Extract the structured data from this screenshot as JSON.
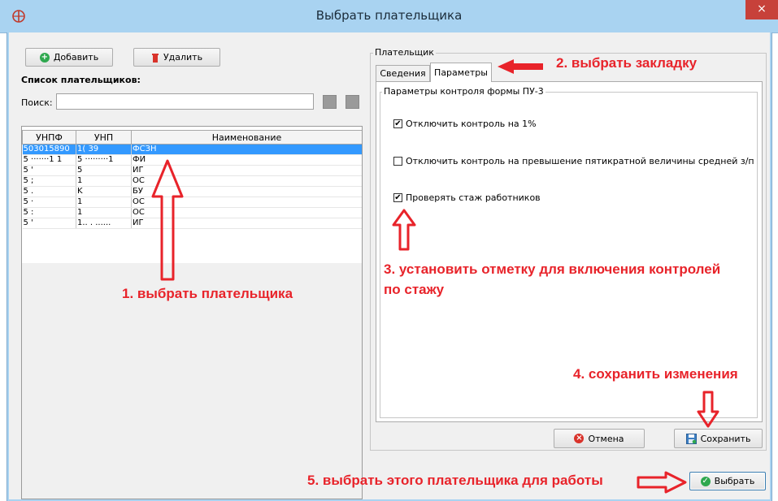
{
  "window": {
    "title": "Выбрать плательщика",
    "close_glyph": "×"
  },
  "toolbar": {
    "add_label": "Добавить",
    "delete_label": "Удалить"
  },
  "payers": {
    "list_title": "Список плательщиков:",
    "search_label": "Поиск:",
    "search_value": "",
    "columns": [
      "УНПФ",
      "УНП",
      "Наименование"
    ],
    "rows": [
      {
        "unpf": "503015890",
        "unp": "1(              39",
        "name": "ФСЗН",
        "selected": true
      },
      {
        "unpf": "5 ·······1 1",
        "unp": "5 ·········1",
        "name": "ФИ",
        "selected": false
      },
      {
        "unpf": "5               '",
        "unp": "5",
        "name": "ИГ",
        "selected": false
      },
      {
        "unpf": "5               ;",
        "unp": "1",
        "name": "ОС",
        "selected": false
      },
      {
        "unpf": "5               .",
        "unp": "K",
        "name": "БУ",
        "selected": false
      },
      {
        "unpf": "5               ·",
        "unp": "1",
        "name": "ОС",
        "selected": false
      },
      {
        "unpf": "5               :",
        "unp": "1",
        "name": "ОС",
        "selected": false
      },
      {
        "unpf": "5               '",
        "unp": "1.. . ......",
        "name": "ИГ",
        "selected": false
      }
    ]
  },
  "payer_panel": {
    "group_title": "Плательщик",
    "tabs": [
      "Сведения",
      "Параметры"
    ],
    "active_tab": "Параметры",
    "section_title": "Параметры контроля формы ПУ-3",
    "checkboxes": [
      {
        "label": "Отключить контроль на 1%",
        "checked": true
      },
      {
        "label": "Отключить контроль на превышение пятикратной величины средней з/п",
        "checked": false
      },
      {
        "label": "Проверять стаж работников",
        "checked": true
      }
    ],
    "cancel_label": "Отмена",
    "save_label": "Сохранить"
  },
  "select_label": "Выбрать",
  "annotations": {
    "step1": "1. выбрать плательщика",
    "step2": "2. выбрать закладку",
    "step3_line1": "3. установить отметку для включения контролей",
    "step3_line2": "по стажу",
    "step4": "4. сохранить изменения",
    "step5": "5. выбрать этого плательщика для работы"
  },
  "colors": {
    "titlebar": "#a9d3f1",
    "selection": "#3399ff",
    "annotation": "#e8232a",
    "close_button": "#c7413a"
  },
  "icons": {
    "app": "app-logo-icon",
    "add": "plus-circle-icon",
    "delete": "trash-icon",
    "cancel": "cancel-circle-icon",
    "save": "floppy-disk-icon",
    "select": "check-circle-icon"
  }
}
